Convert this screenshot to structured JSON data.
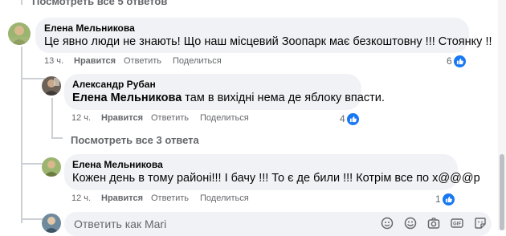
{
  "top_link": {
    "label": "Посмотреть все 5 ответов"
  },
  "comments": [
    {
      "author": "Елена Мельникова",
      "text": "Це явно люди не знають! Що наш місцевий Зоопарк має безкоштовну !!! Стоянку !!",
      "time": "13 ч.",
      "like": "Нравится",
      "reply": "Ответить",
      "share": "Поделиться",
      "reactions": "6"
    },
    {
      "author": "Александр Рубан",
      "mention": "Елена Мельникова",
      "text": " там в вихідні нема де яблоку впасти.",
      "time": "12 ч.",
      "like": "Нравится",
      "reply": "Ответить",
      "share": "Поделиться",
      "reactions": "4"
    },
    {
      "author": "Елена Мельникова",
      "text": "Кожен день в тому районі!!! І бачу !!! То є де били !!! Котрім все по х@@@р",
      "time": "12 ч.",
      "like": "Нравится",
      "reply": "Ответить",
      "share": "Поделиться",
      "reactions": "1"
    }
  ],
  "more_replies": {
    "label": "Посмотреть все 3 ответа"
  },
  "reply_box": {
    "placeholder": "Ответить как Mari"
  },
  "icons": [
    "sticker-icon",
    "emoji-icon",
    "camera-icon",
    "gif-icon",
    "sticker2-icon"
  ],
  "colors": {
    "bubble": "#f0f2f5",
    "meta": "#65676b",
    "like": "#1877f2"
  }
}
